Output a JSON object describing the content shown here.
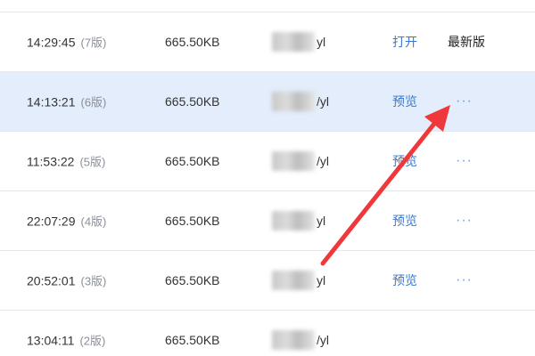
{
  "versions": [
    {
      "time": "14:29:45",
      "version": "(7版)",
      "size": "665.50KB",
      "modifier_suffix": "yl",
      "action": "打开",
      "tag": "最新版",
      "more": ""
    },
    {
      "time": "14:13:21",
      "version": "(6版)",
      "size": "665.50KB",
      "modifier_suffix": "/yl",
      "action": "预览",
      "tag": "",
      "more": "···"
    },
    {
      "time": "11:53:22",
      "version": "(5版)",
      "size": "665.50KB",
      "modifier_suffix": "/yl",
      "action": "预览",
      "tag": "",
      "more": "···"
    },
    {
      "time": "22:07:29",
      "version": "(4版)",
      "size": "665.50KB",
      "modifier_suffix": "yl",
      "action": "预览",
      "tag": "",
      "more": "···"
    },
    {
      "time": "20:52:01",
      "version": "(3版)",
      "size": "665.50KB",
      "modifier_suffix": "yl",
      "action": "预览",
      "tag": "",
      "more": "···"
    },
    {
      "time": "13:04:11",
      "version": "(2版)",
      "size": "665.50KB",
      "modifier_suffix": "/yl",
      "action": "",
      "tag": "",
      "more": ""
    }
  ],
  "selected_row": 1,
  "annotation": {
    "type": "arrow",
    "color": "#f0383a",
    "points_to": "more-button-row-6"
  },
  "colors": {
    "selected_bg": "#e3edfb",
    "link": "#3a78d0",
    "more": "#7a9cd6",
    "divider": "#e6e8ec"
  }
}
